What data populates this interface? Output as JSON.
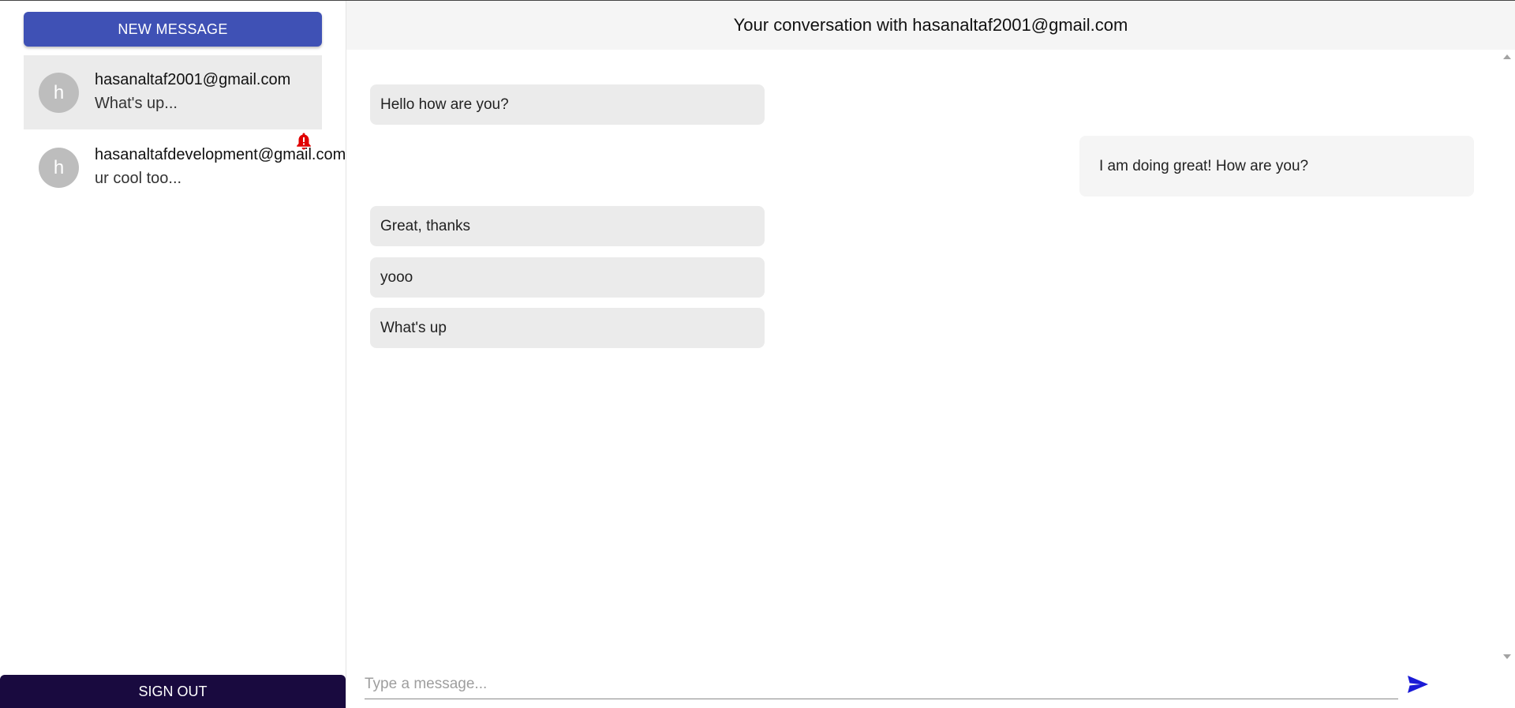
{
  "sidebar": {
    "new_message_label": "NEW MESSAGE",
    "sign_out_label": "SIGN OUT",
    "conversations": [
      {
        "avatar_letter": "h",
        "email": "hasanaltaf2001@gmail.com",
        "preview": "What's up...",
        "active": true,
        "has_notification": false
      },
      {
        "avatar_letter": "h",
        "email": "hasanaltafdevelopment@gmail.com",
        "preview": "ur cool too...",
        "active": false,
        "has_notification": true
      }
    ]
  },
  "header": {
    "title": "Your conversation with hasanaltaf2001@gmail.com"
  },
  "messages": [
    {
      "text": "Hello how are you?",
      "from": "received"
    },
    {
      "text": "I am doing great! How are you?",
      "from": "sent"
    },
    {
      "text": "Great, thanks",
      "from": "received"
    },
    {
      "text": "yooo",
      "from": "received"
    },
    {
      "text": "What's up",
      "from": "received"
    }
  ],
  "composer": {
    "placeholder": "Type a message..."
  },
  "icons": {
    "send": "send-icon",
    "notification": "bell-alert-icon"
  },
  "colors": {
    "primary": "#3f51b5",
    "sign_out_bg": "#190a3f",
    "send_icon": "#1a1ad6",
    "notification": "#e00000"
  }
}
